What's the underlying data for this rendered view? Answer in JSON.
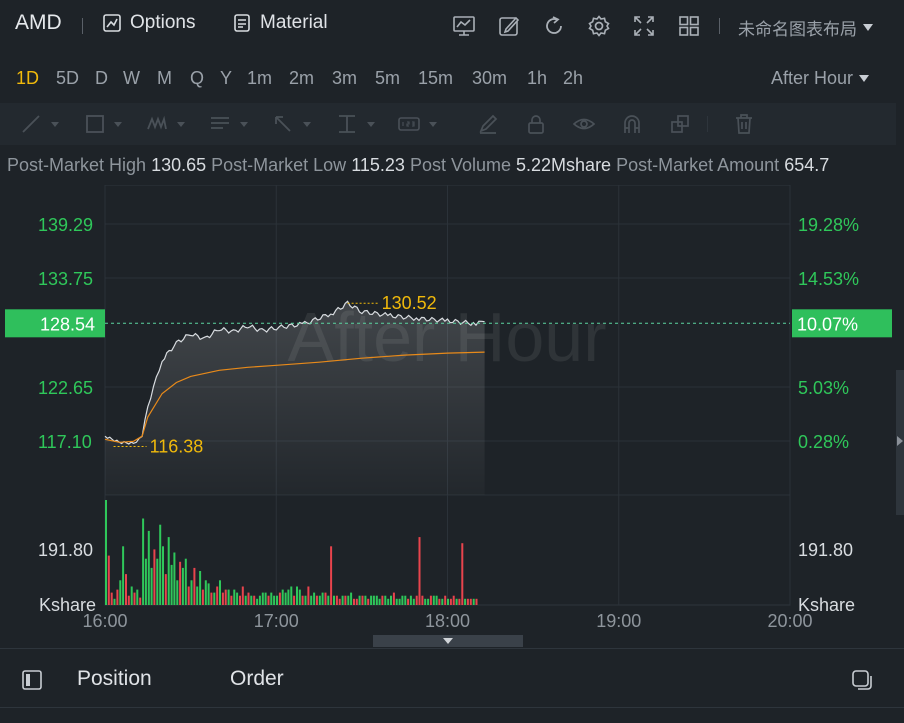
{
  "header": {
    "symbol": "AMD",
    "options_label": "Options",
    "material_label": "Material",
    "layout_name": "未命名图表布局",
    "icons": [
      "chart-indicator-icon",
      "draw-edit-icon",
      "refresh-icon",
      "settings-icon",
      "fullscreen-icon",
      "layout-grid-icon"
    ]
  },
  "periods": [
    {
      "label": "1D",
      "active": true
    },
    {
      "label": "5D"
    },
    {
      "label": "D"
    },
    {
      "label": "W"
    },
    {
      "label": "M"
    },
    {
      "label": "Q"
    },
    {
      "label": "Y"
    },
    {
      "label": "1m"
    },
    {
      "label": "2m"
    },
    {
      "label": "3m"
    },
    {
      "label": "5m"
    },
    {
      "label": "15m"
    },
    {
      "label": "30m"
    },
    {
      "label": "1h"
    },
    {
      "label": "2h"
    }
  ],
  "session_selector": "After Hour",
  "stats": {
    "high_label": "Post-Market High",
    "high_value": "130.65",
    "low_label": "Post-Market Low",
    "low_value": "115.23",
    "volume_label": "Post Volume",
    "volume_value": "5.22Mshare",
    "amount_label": "Post-Market Amount",
    "amount_value": "654.7"
  },
  "chart": {
    "watermark": "After Hour",
    "price_axis_left": [
      "139.29",
      "133.75",
      "122.65",
      "117.10"
    ],
    "pct_axis_right": [
      "19.28%",
      "14.53%",
      "5.03%",
      "0.28%"
    ],
    "current_price": "128.54",
    "current_pct": "10.07%",
    "high_marker": "130.52",
    "low_marker": "116.38",
    "volume_axis_value": "191.80",
    "volume_unit": "Kshare",
    "time_labels": [
      "16:00",
      "17:00",
      "18:00",
      "19:00",
      "20:00"
    ],
    "colors": {
      "up": "#2fc75a",
      "down": "#e8444d",
      "line": "#d8dce0",
      "avg": "#e88a1a",
      "marker": "#f0b90b",
      "current_bg": "#2fbf5c"
    }
  },
  "chart_data": {
    "type": "line",
    "title": "",
    "xlabel": "",
    "ylabel": "",
    "x_range": [
      "16:00",
      "20:00"
    ],
    "ylim": [
      111.6,
      141.2
    ],
    "series": [
      {
        "x": [
          "16:00",
          "16:05",
          "16:10",
          "16:13",
          "16:15",
          "16:17",
          "16:20",
          "16:25",
          "16:30",
          "16:35",
          "16:40",
          "16:45",
          "16:50",
          "16:55",
          "17:00",
          "17:10",
          "17:20",
          "17:25",
          "17:30",
          "17:40",
          "17:50",
          "18:00",
          "18:10",
          "18:13"
        ],
        "values": [
          117.4,
          116.8,
          116.7,
          117.3,
          120.4,
          122.2,
          124.9,
          126.6,
          127.5,
          127.0,
          128.0,
          127.7,
          128.3,
          127.8,
          128.1,
          128.5,
          129.6,
          130.5,
          129.7,
          129.3,
          129.0,
          128.8,
          128.5,
          128.7
        ]
      },
      {
        "x": [
          "16:00",
          "16:05",
          "16:10",
          "16:13",
          "16:15",
          "16:20",
          "16:25",
          "16:30",
          "16:40",
          "16:50",
          "17:00",
          "17:15",
          "17:30",
          "17:45",
          "18:00",
          "18:13"
        ],
        "values": [
          117.1,
          116.8,
          116.9,
          117.4,
          119.3,
          121.6,
          122.7,
          123.3,
          123.9,
          124.2,
          124.4,
          124.7,
          125.1,
          125.4,
          125.6,
          125.7
        ]
      }
    ],
    "volume": {
      "unit": "Kshare",
      "max_label": 191.8,
      "values": [
        170,
        80,
        20,
        10,
        25,
        40,
        95,
        50,
        15,
        30,
        20,
        25,
        12,
        140,
        75,
        120,
        60,
        90,
        75,
        130,
        95,
        50,
        110,
        65,
        85,
        40,
        70,
        60,
        75,
        30,
        40,
        60,
        30,
        55,
        25,
        40,
        35,
        20,
        20,
        30,
        40,
        20,
        25,
        25,
        15,
        25,
        20,
        15,
        30,
        15,
        20,
        15,
        15,
        10,
        15,
        20,
        20,
        15,
        20,
        15,
        15,
        20,
        25,
        20,
        25,
        30,
        15,
        30,
        25,
        15,
        15,
        30,
        15,
        20,
        15,
        15,
        20,
        20,
        15,
        95,
        15,
        15,
        10,
        15,
        15,
        15,
        20,
        10,
        10,
        15,
        15,
        15,
        10,
        15,
        15,
        15,
        10,
        15,
        15,
        10,
        15,
        20,
        10,
        10,
        15,
        15,
        10,
        15,
        10,
        15,
        110,
        15,
        10,
        10,
        15,
        15,
        15,
        10,
        10,
        15,
        10,
        10,
        15,
        10,
        10,
        100,
        10,
        10,
        10,
        10,
        10
      ],
      "up_down": "mixed"
    }
  },
  "footer": {
    "tabs": [
      "Position",
      "Order"
    ]
  }
}
